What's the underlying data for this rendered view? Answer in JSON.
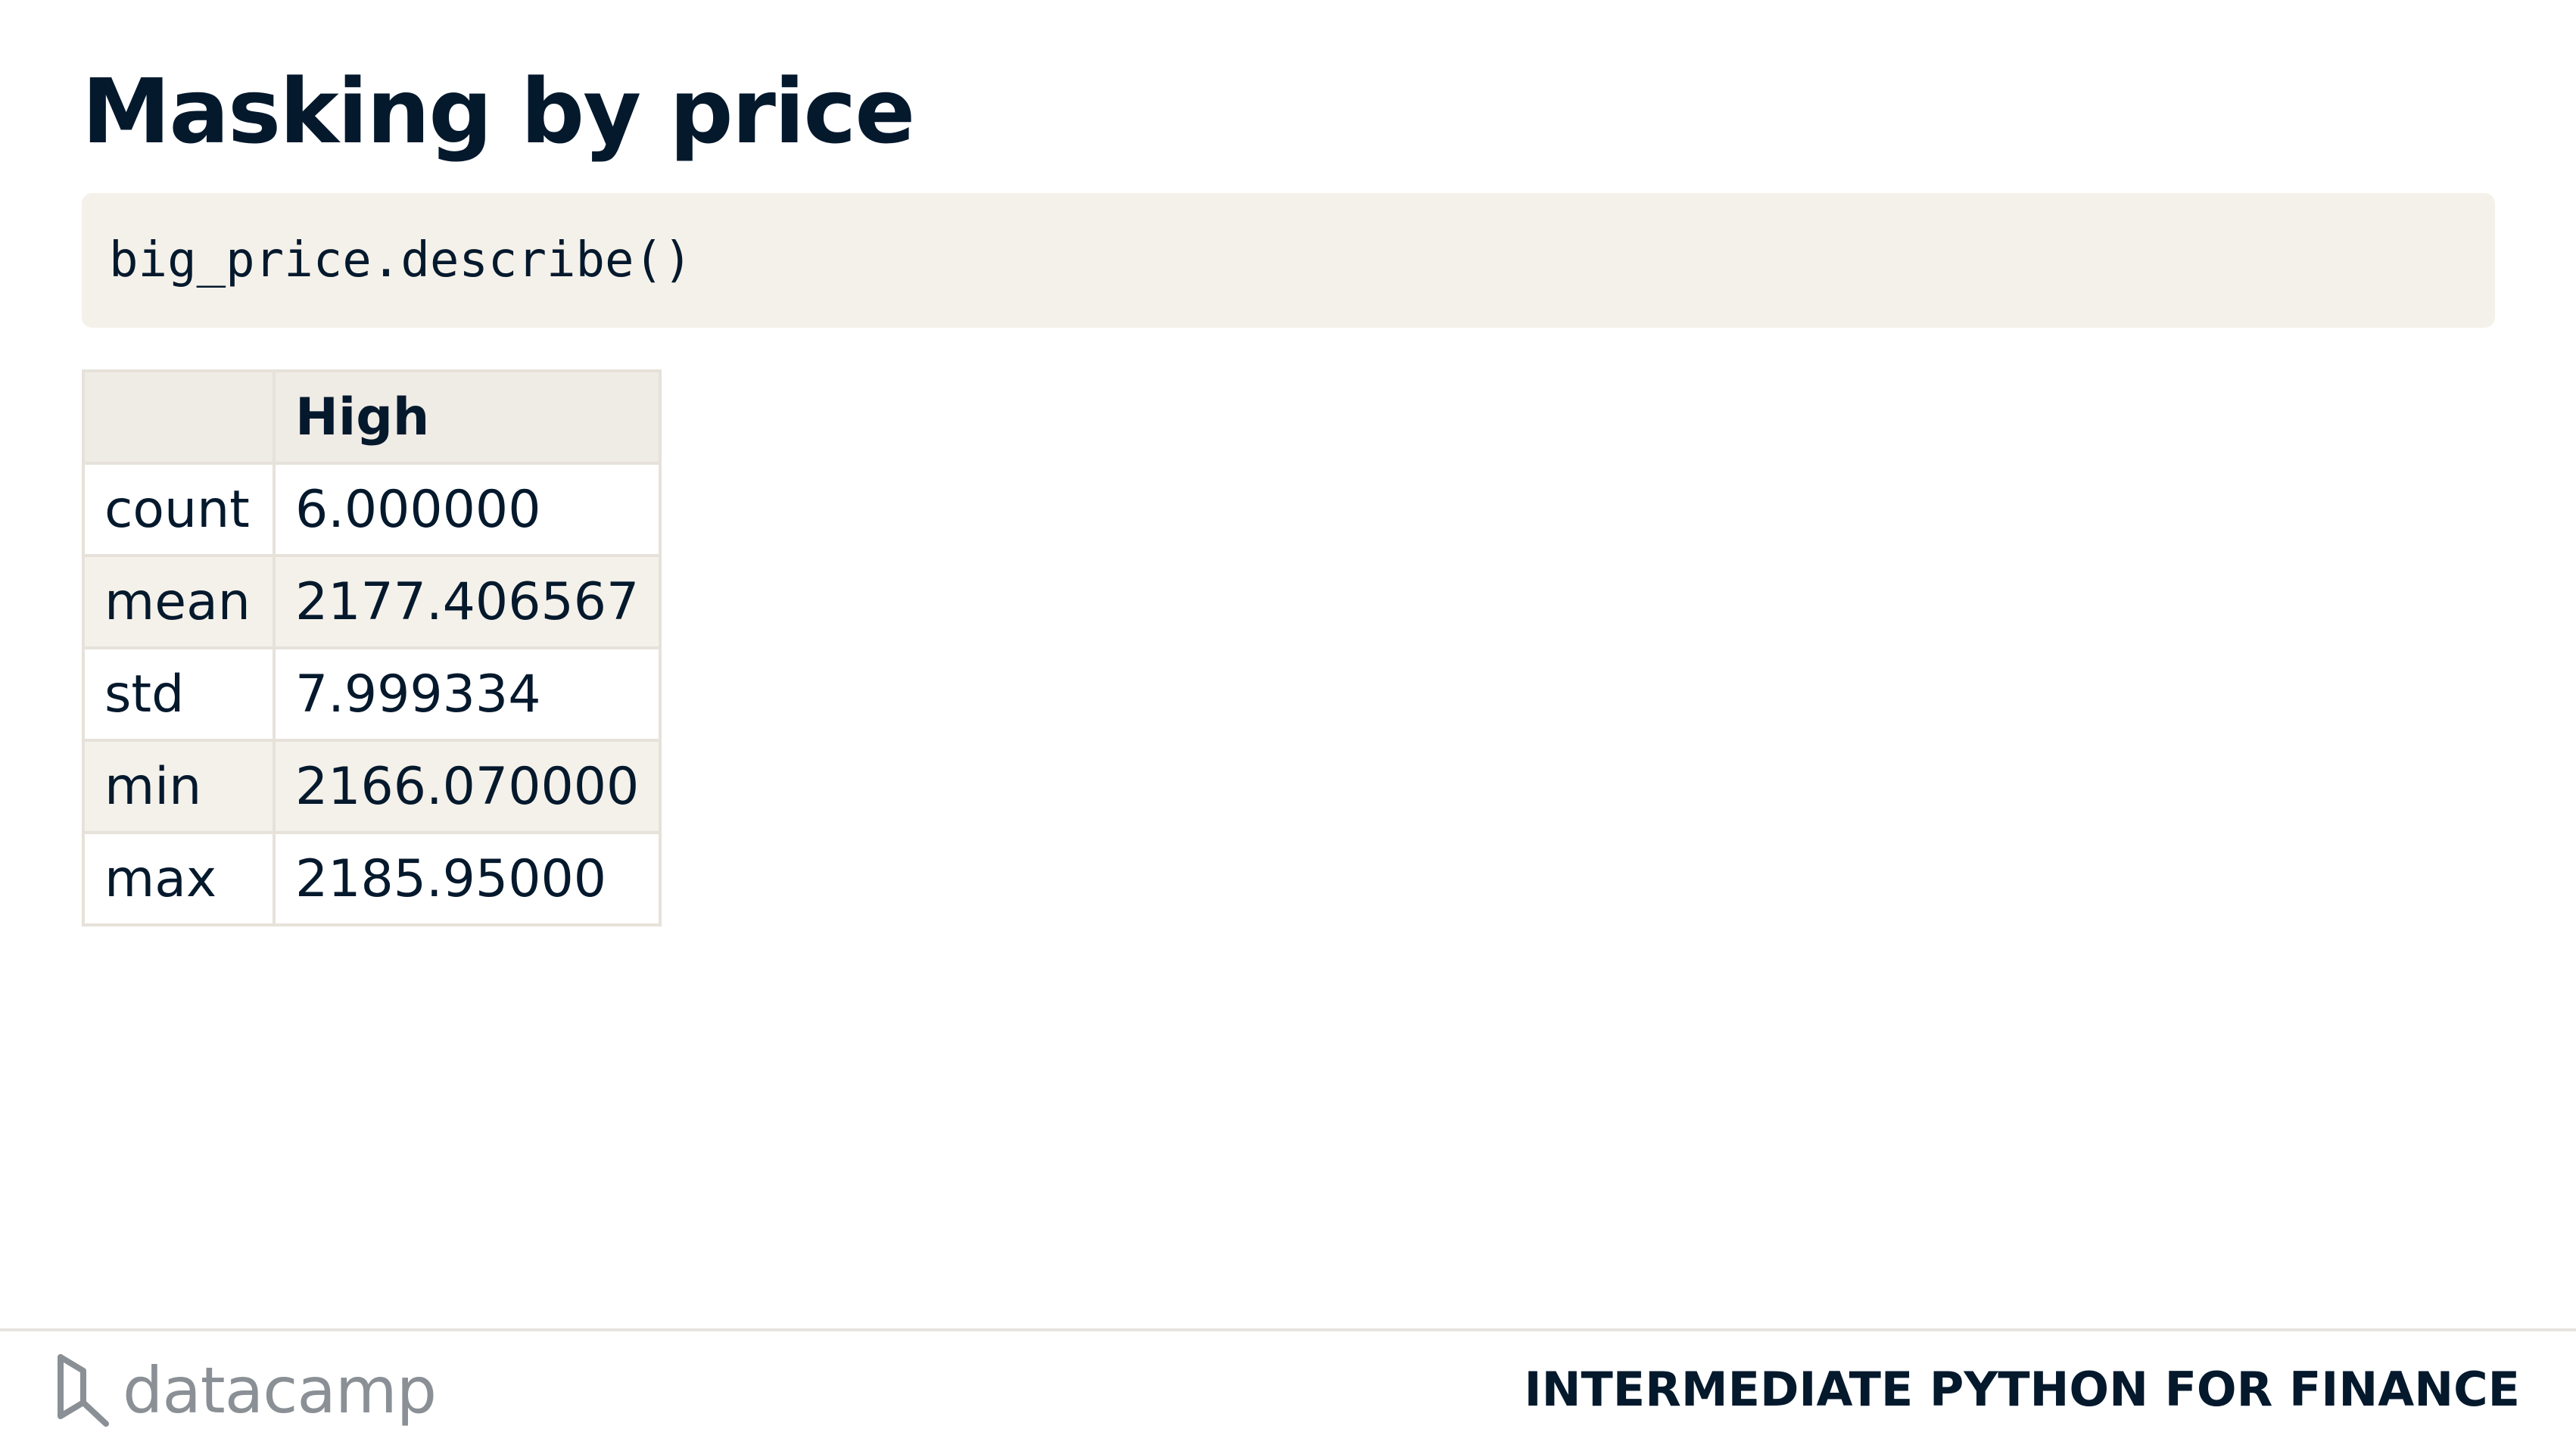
{
  "slide": {
    "title": "Masking by price"
  },
  "code": {
    "text": "big_price.describe()"
  },
  "table": {
    "header": [
      "",
      "High"
    ],
    "rows": [
      {
        "label": "count",
        "value": "6.000000"
      },
      {
        "label": "mean",
        "value": "2177.406567"
      },
      {
        "label": "std",
        "value": "7.999334"
      },
      {
        "label": "min",
        "value": "2166.070000"
      },
      {
        "label": "max",
        "value": "2185.95000"
      }
    ]
  },
  "footer": {
    "brand": "datacamp",
    "logo_icon": "datacamp-logo-icon",
    "course": "INTERMEDIATE PYTHON FOR FINANCE"
  },
  "colors": {
    "text": "#05192d",
    "code_background": "#f4f1ea",
    "table_header_background": "#efebe5",
    "brand_gray": "#8a9095"
  }
}
